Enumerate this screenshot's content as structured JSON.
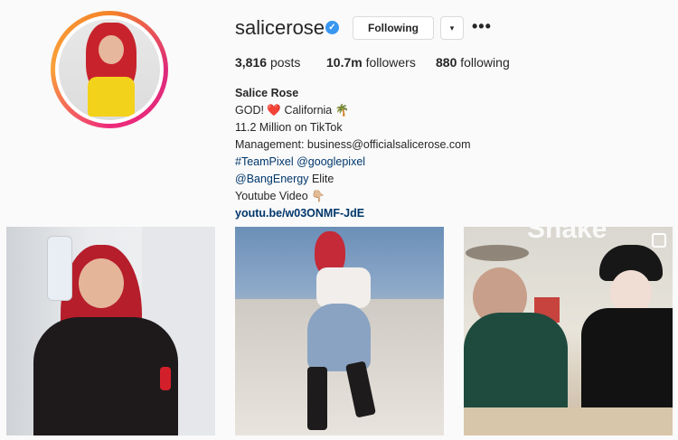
{
  "profile": {
    "username": "salicerose",
    "verified_mark": "✓",
    "follow_label": "Following",
    "dropdown_icon": "▾",
    "more_icon": "•••",
    "stats": {
      "posts_count": "3,816",
      "posts_label": "posts",
      "followers_count": "10.7m",
      "followers_label": "followers",
      "following_count": "880",
      "following_label": "following"
    },
    "bio": {
      "name": "Salice Rose",
      "line1": "GOD! ❤️ California 🌴",
      "line2": "11.2 Million on TikTok",
      "line3": "Management: business@officialsalicerose.com",
      "hashtag": "#TeamPixel",
      "mention_google": "@googlepixel",
      "mention_bang": "@BangEnergy",
      "elite": " Elite",
      "line6": "Youtube Video 👇🏼",
      "url": "youtu.be/w03ONMF-JdE"
    }
  },
  "posts": [
    {
      "name": "post-1"
    },
    {
      "name": "post-2"
    },
    {
      "name": "post-3",
      "overlay_text": "Shake"
    }
  ],
  "colors": {
    "link": "#00376b",
    "verified": "#3897f0",
    "background": "#fafafa"
  }
}
